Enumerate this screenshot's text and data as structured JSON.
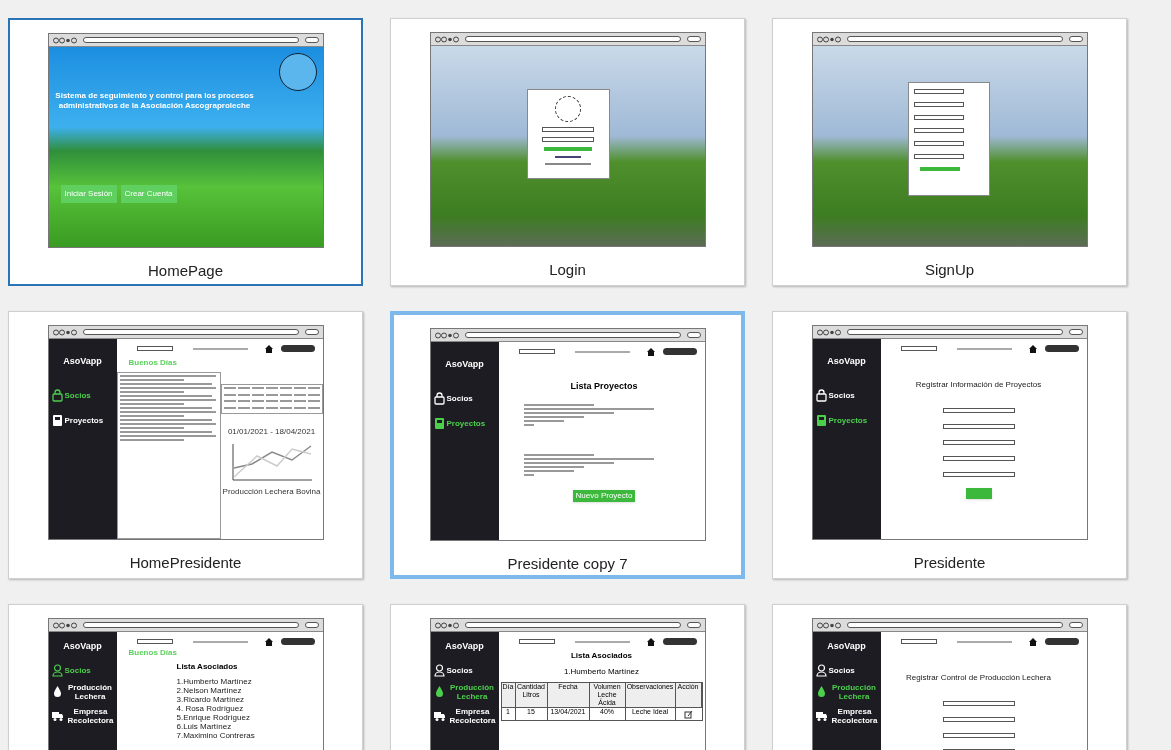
{
  "cards": [
    {
      "title": "HomePage",
      "selected": true,
      "hovered": false,
      "mockup": {
        "kind": "landing",
        "headline": "Sistema de seguimiento y control para los procesos administrativos de la Asociación Ascograproleche",
        "buttons": [
          "Iniciar Sesión",
          "Crear Cuenta"
        ]
      }
    },
    {
      "title": "Login",
      "selected": false,
      "hovered": false,
      "mockup": {
        "kind": "login"
      }
    },
    {
      "title": "SignUp",
      "selected": false,
      "hovered": false,
      "mockup": {
        "kind": "signup"
      }
    },
    {
      "title": "HomePresidente",
      "selected": false,
      "hovered": false,
      "mockup": {
        "kind": "dashboard",
        "brand": "AsoVapp",
        "nav": [
          {
            "label": "Socios",
            "selected": true
          },
          {
            "label": "Proyectos",
            "selected": false
          }
        ],
        "greeting": "Buenos Días",
        "chart_title": "01/01/2021 - 18/04/2021",
        "chart_caption": "Producción Lechera Bovina"
      }
    },
    {
      "title": "Presidente copy 7",
      "selected": false,
      "hovered": true,
      "mockup": {
        "kind": "project_list",
        "brand": "AsoVapp",
        "nav": [
          {
            "label": "Socios",
            "selected": false
          },
          {
            "label": "Proyectos",
            "selected": true
          }
        ],
        "heading": "Lista Proyectos",
        "button": "Nuevo Proyecto"
      }
    },
    {
      "title": "Presidente",
      "selected": false,
      "hovered": false,
      "mockup": {
        "kind": "form",
        "brand": "AsoVapp",
        "nav": [
          {
            "label": "Socios",
            "selected": false
          },
          {
            "label": "Proyectos",
            "selected": true
          }
        ],
        "heading": "Registrar Información de Proyectos"
      }
    },
    {
      "selected": false,
      "hovered": false,
      "mockup": {
        "kind": "associates",
        "brand": "AsoVapp",
        "nav": [
          {
            "label": "Socios",
            "selected": true
          },
          {
            "label": "Producción Lechera",
            "selected": false
          },
          {
            "label": "Empresa Recolectora",
            "selected": false
          }
        ],
        "greeting": "Buenos Días",
        "heading": "Lista Asociados",
        "items": [
          "1.Humberto Martínez",
          "2.Nelson Martínez",
          "3.Ricardo Martínez",
          "4. Rosa Rodríguez",
          "5.Enrique Rodríguez",
          "6.Luis Martínez",
          "7.Maximino Contreras"
        ]
      }
    },
    {
      "selected": false,
      "hovered": false,
      "mockup": {
        "kind": "production_table",
        "brand": "AsoVapp",
        "nav": [
          {
            "label": "Socios",
            "selected": false
          },
          {
            "label": "Producción Lechera",
            "selected": true
          },
          {
            "label": "Empresa Recolectora",
            "selected": false
          }
        ],
        "heading": "Lista Asociados",
        "subheading": "1.Humberto Martínez",
        "columns": [
          "Día",
          "Cantidad Litros",
          "Fecha",
          "Volumen Leche Ácida",
          "Observaciones",
          "Acción"
        ],
        "row": [
          "1",
          "15",
          "13/04/2021",
          "40%",
          "Leche Ideal"
        ]
      }
    },
    {
      "selected": false,
      "hovered": false,
      "mockup": {
        "kind": "form_short",
        "brand": "AsoVapp",
        "nav": [
          {
            "label": "Socios",
            "selected": false
          },
          {
            "label": "Producción Lechera",
            "selected": true
          },
          {
            "label": "Empresa Recolectora",
            "selected": false
          }
        ],
        "heading": "Registrar Control de Producción Lechera"
      }
    }
  ]
}
